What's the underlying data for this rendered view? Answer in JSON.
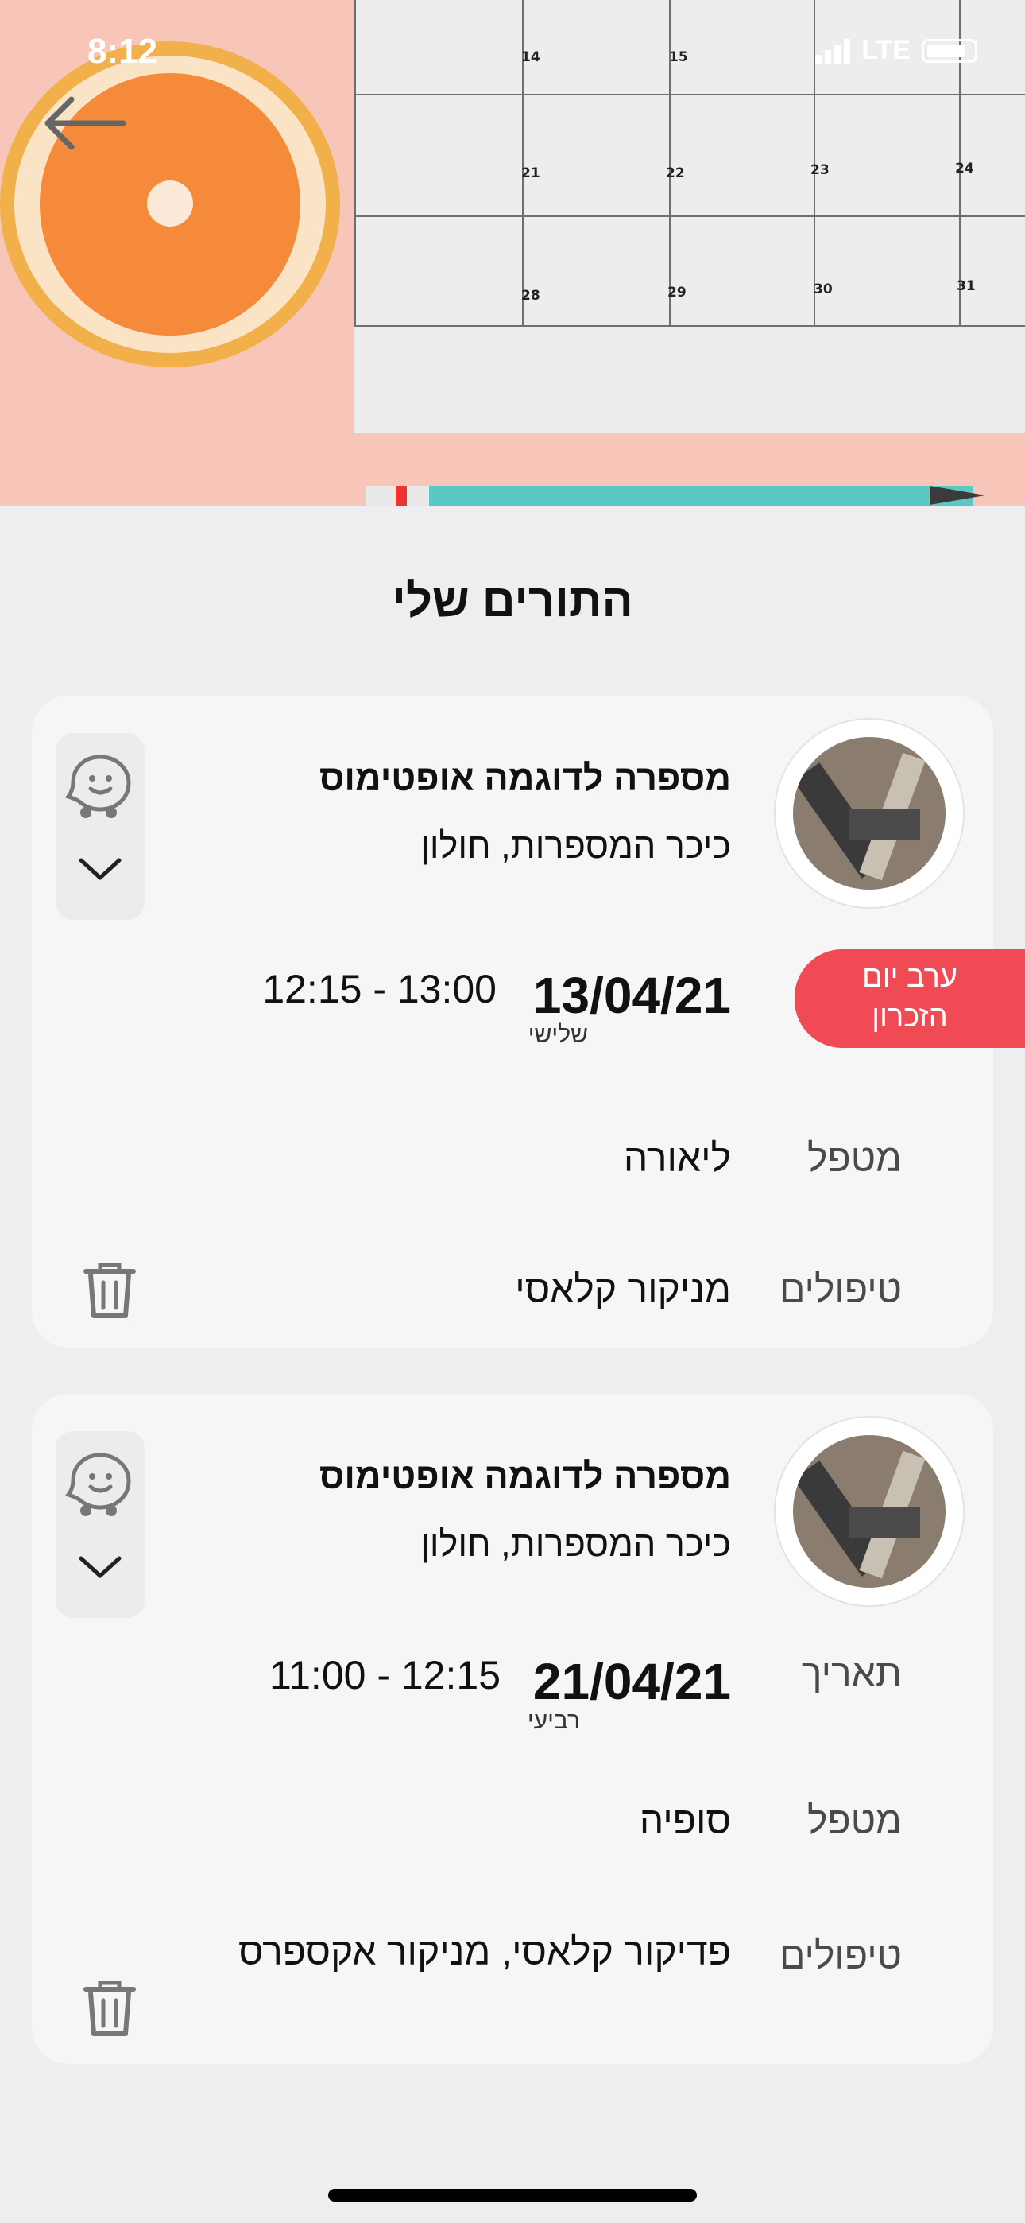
{
  "status_bar": {
    "time": "8:12",
    "network": "LTE",
    "icons": [
      "signal-icon",
      "battery-icon"
    ]
  },
  "header": {
    "back_icon": "arrow-left-icon",
    "calendar_dates": [
      "14",
      "15",
      "21",
      "22",
      "23",
      "24",
      "28",
      "29",
      "30",
      "31"
    ]
  },
  "page": {
    "title": "התורים שלי"
  },
  "appointments": [
    {
      "business_name": "מספרה לדוגמה אופטימוס",
      "address": "כיכר המספרות, חולון",
      "badge_line1": "ערב יום",
      "badge_line2": "הזכרון",
      "badge_color": "#f04b55",
      "date": "13/04/21",
      "weekday": "שלישי",
      "time_range": "12:15 - 13:00",
      "therapist_label": "מטפל",
      "therapist": "ליאורה",
      "treatments_label": "טיפולים",
      "treatments": "מניקור קלאסי"
    },
    {
      "business_name": "מספרה לדוגמה אופטימוס",
      "address": "כיכר המספרות, חולון",
      "date_label": "תאריך",
      "date": "21/04/21",
      "weekday": "רביעי",
      "time_range": "11:00 - 12:15",
      "therapist_label": "מטפל",
      "therapist": "סופיה",
      "treatments_label": "טיפולים",
      "treatments": "פדיקור קלאסי, מניקור אקספרס"
    }
  ],
  "icons": {
    "navigate": "waze-icon",
    "expand": "chevron-down-icon",
    "delete": "trash-icon"
  }
}
